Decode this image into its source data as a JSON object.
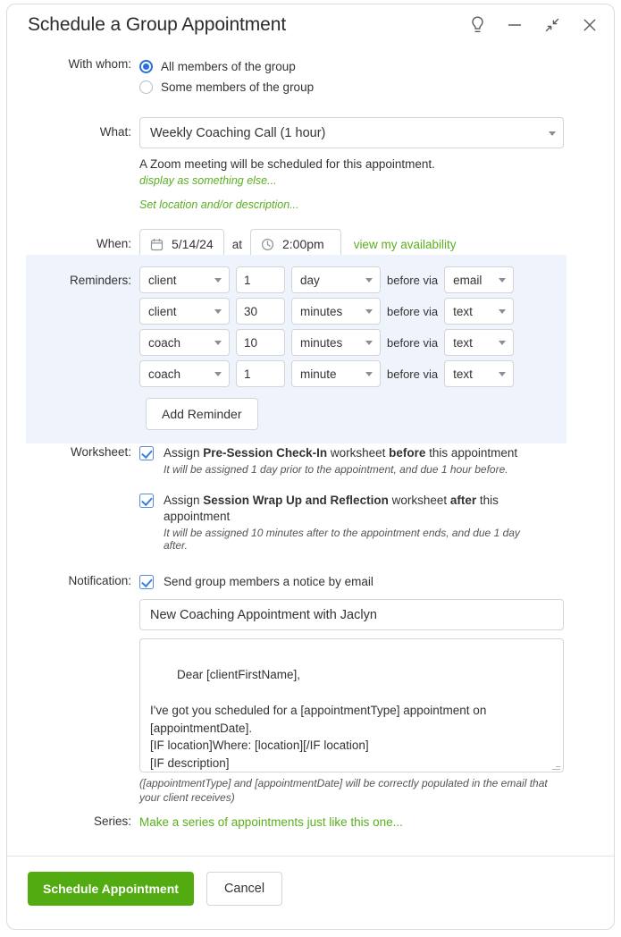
{
  "window": {
    "title": "Schedule a Group Appointment",
    "controls": [
      {
        "name": "tip-lightbulb-icon",
        "label": "Tip"
      },
      {
        "name": "minimize-icon",
        "label": "Minimize"
      },
      {
        "name": "restore-icon",
        "label": "Restore"
      },
      {
        "name": "close-icon",
        "label": "Close"
      }
    ]
  },
  "colors": {
    "accent_green": "#52ab10",
    "link_green": "#5aaf1e",
    "accent_blue": "#2a6fdb",
    "checkbox_blue": "#3b7ddd",
    "reminders_panel_bg": "#eef3fc",
    "border": "#d2d5da"
  },
  "with_whom": {
    "label": "With whom:",
    "options": [
      {
        "label": "All members of the group",
        "selected": true
      },
      {
        "label": "Some members of the group",
        "selected": false
      }
    ]
  },
  "what": {
    "label": "What:",
    "value": "Weekly Coaching Call (1 hour)",
    "note": "A Zoom meeting will be scheduled for this appointment.",
    "link_display_as": "display as something else...",
    "link_set_location": "Set location and/or description..."
  },
  "when": {
    "label": "When:",
    "date": "5/14/24",
    "separator": "at",
    "time": "2:00pm",
    "availability_link": "view my availability"
  },
  "reminders": {
    "label": "Reminders:",
    "before_via_label": "before via",
    "rows": [
      {
        "who": "client",
        "amount": "1",
        "unit": "day",
        "via": "email"
      },
      {
        "who": "client",
        "amount": "30",
        "unit": "minutes",
        "via": "text"
      },
      {
        "who": "coach",
        "amount": "10",
        "unit": "minutes",
        "via": "text"
      },
      {
        "who": "coach",
        "amount": "1",
        "unit": "minute",
        "via": "text"
      }
    ],
    "add_button": "Add Reminder"
  },
  "worksheet": {
    "label": "Worksheet:",
    "items": [
      {
        "checked": true,
        "text_pre": "Assign ",
        "name": "Pre-Session Check-In",
        "text_mid": " worksheet ",
        "emphasis": "before",
        "text_post": " this appointment",
        "sub": "It will be assigned 1 day prior to the appointment, and due 1 hour before."
      },
      {
        "checked": true,
        "text_pre": "Assign ",
        "name": "Session Wrap Up and Reflection",
        "text_mid": " worksheet ",
        "emphasis": "after",
        "text_post": " this appointment",
        "sub": "It will be assigned 10 minutes after to the appointment ends, and due 1 day after."
      }
    ]
  },
  "notification": {
    "label": "Notification:",
    "checkbox_checked": true,
    "checkbox_label": "Send group members a notice by email",
    "subject": "New Coaching Appointment with Jaclyn",
    "body": "Dear [clientFirstName],\n\nI've got you scheduled for a [appointmentType] appointment on [appointmentDate].\n[IF location]Where: [location][/IF location]\n[IF description]\n============",
    "helper": "([appointmentType] and [appointmentDate] will be correctly populated in the email that your client receives)"
  },
  "series": {
    "label": "Series:",
    "link": "Make a series of appointments just like this one..."
  },
  "footer": {
    "primary": "Schedule Appointment",
    "secondary": "Cancel"
  }
}
